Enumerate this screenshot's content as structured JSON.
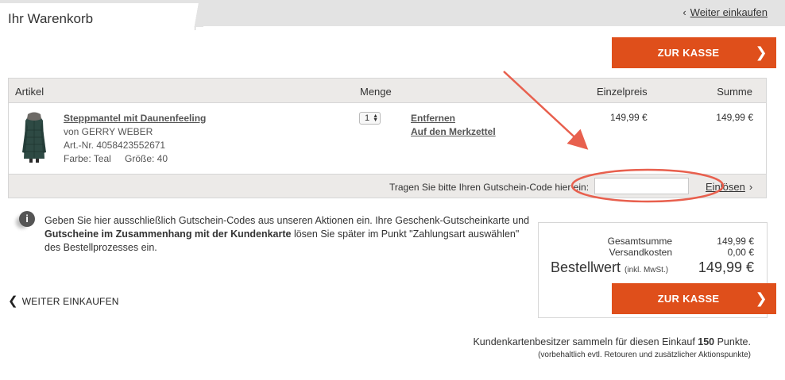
{
  "header": {
    "title": "Ihr Warenkorb",
    "continue_link": "Weiter einkaufen"
  },
  "checkout_button": {
    "label": "ZUR KASSE"
  },
  "cart": {
    "columns": {
      "article": "Artikel",
      "quantity": "Menge",
      "unit_price": "Einzelpreis",
      "total": "Summe"
    },
    "item": {
      "name": "Steppmantel mit Daunenfeeling",
      "brand": "von GERRY WEBER",
      "article_no": "Art.-Nr. 4058423552671",
      "color": "Farbe: Teal",
      "size": "Größe: 40",
      "quantity": "1",
      "remove": "Entfernen",
      "wishlist": "Auf den Merkzettel",
      "unit_price": "149,99 €",
      "total": "149,99 €"
    },
    "coupon": {
      "label": "Tragen Sie bitte Ihren Gutschein-Code hier ein:",
      "input_value": "",
      "redeem": "Einlösen"
    }
  },
  "info": {
    "part1": "Geben Sie hier ausschließlich Gutschein-Codes aus unseren Aktionen ein. Ihre Geschenk-Gutscheinkarte und ",
    "bold": "Gutscheine im Zusammenhang mit der Kundenkarte",
    "part2": " lösen Sie später im Punkt \"Zahlungsart auswählen\" des Bestellprozesses ein."
  },
  "continue_bottom": "WEITER EINKAUFEN",
  "summary": {
    "total_label": "Gesamtsumme",
    "total_value": "149,99 €",
    "shipping_label": "Versandkosten",
    "shipping_value": "0,00 €",
    "order_label": "Bestellwert",
    "order_note": "(inkl. MwSt.)",
    "order_value": "149,99 €"
  },
  "points": {
    "text_before": "Kundenkartenbesitzer sammeln für diesen Einkauf ",
    "value": "150",
    "text_after": " Punkte.",
    "note": "(vorbehaltlich evtl. Retouren und zusätzlicher Aktionspunkte)"
  },
  "colors": {
    "accent": "#df4f1b",
    "annotation": "#e8604e",
    "header_bg": "#eceae8"
  },
  "icons": {
    "info": "info-icon",
    "chevron_left": "chevron-left-icon",
    "chevron_right": "chevron-right-icon"
  }
}
